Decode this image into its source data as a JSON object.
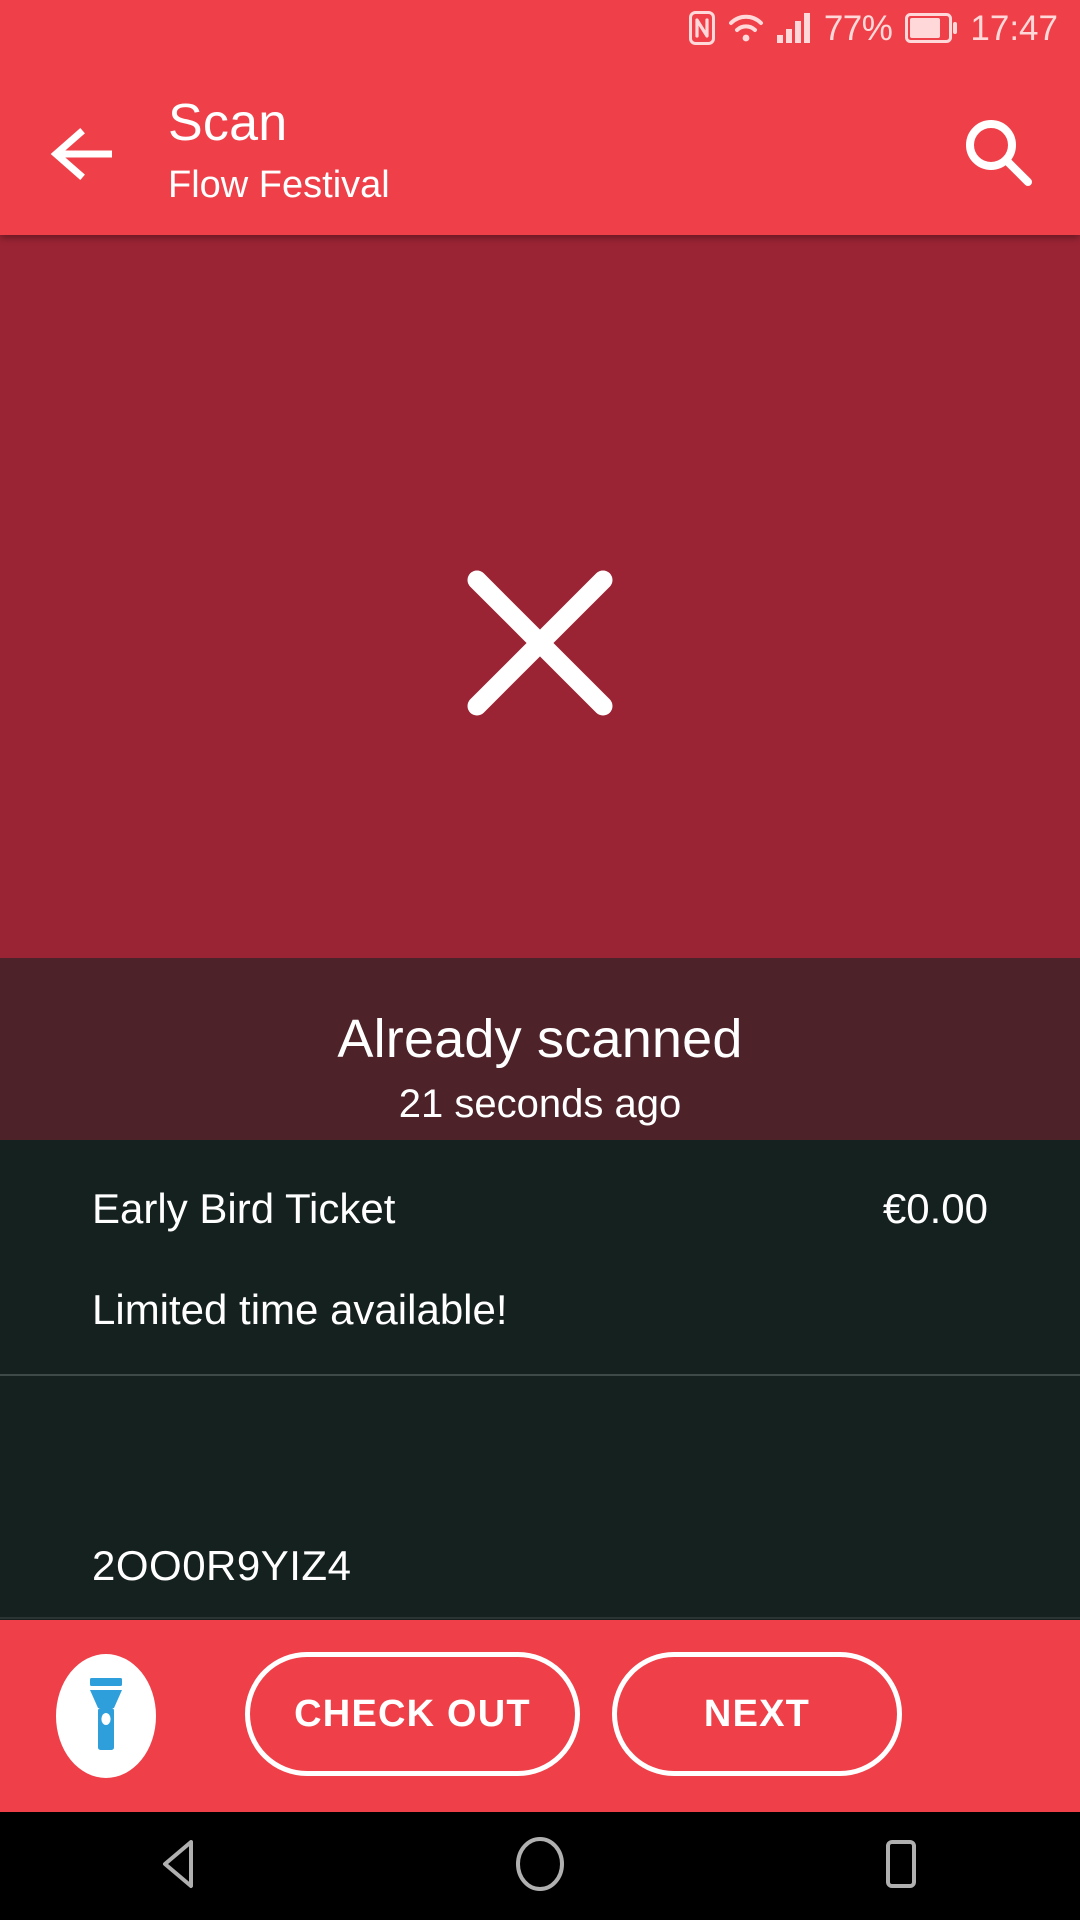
{
  "status_bar": {
    "nfc_icon": "nfc-icon",
    "wifi_icon": "wifi-icon",
    "signal_icon": "signal-bars-icon",
    "battery_percent": "77%",
    "battery_icon": "battery-icon",
    "time": "17:47"
  },
  "header": {
    "back_icon": "back-arrow-icon",
    "title": "Scan",
    "subtitle": "Flow Festival",
    "search_icon": "search-icon",
    "background_color": "#ef4049"
  },
  "scan_result": {
    "icon": "cross-icon",
    "background_color": "#9b2434",
    "status_title": "Already scanned",
    "status_time": "21 seconds ago",
    "status_background_color": "#4d2229"
  },
  "ticket": {
    "name": "Early Bird Ticket",
    "price": "€0.00",
    "note": "Limited time available!",
    "code": "2OO0R9YIZ4",
    "background_color": "#15211f"
  },
  "actions": {
    "torch_icon": "flashlight-icon",
    "torch_color": "#2f9fdb",
    "check_out_label": "CHECK OUT",
    "next_label": "NEXT"
  },
  "nav_bar": {
    "back_icon": "nav-back-triangle-icon",
    "home_icon": "nav-home-circle-icon",
    "recents_icon": "nav-recents-square-icon"
  }
}
